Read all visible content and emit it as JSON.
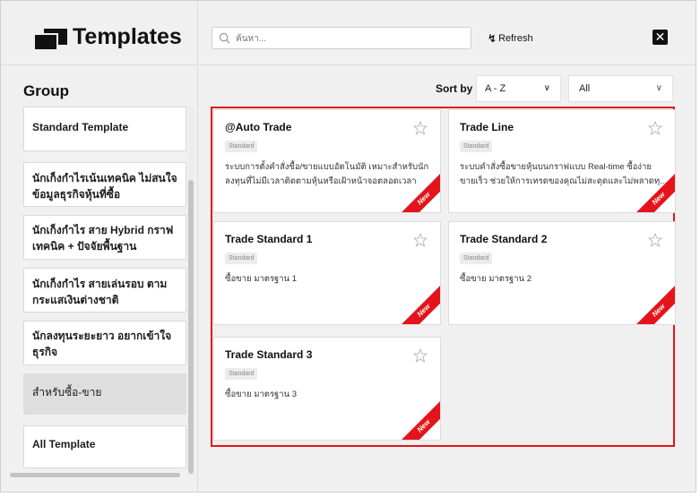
{
  "app": {
    "title": "Templates"
  },
  "sidebar": {
    "group_title": "Group",
    "items": [
      {
        "label": "Standard Template"
      },
      {
        "label_line1": "นักเก็งกำไรเน้นเทคนิค ไม่สนใจ",
        "label_line2": "ข้อมูลธุรกิจหุ้นที่ซื้อ"
      },
      {
        "label_line1": "นักเก็งกำไร สาย Hybrid กราฟ",
        "label_line2": "เทคนิค + ปัจจัยพื้นฐาน"
      },
      {
        "label_line1": "นักเก็งกำไร สายเล่นรอบ ตาม",
        "label_line2": "กระแสเงินต่างชาติ"
      },
      {
        "label_line1": "นักลงทุนระยะยาว อยากเข้าใจ",
        "label_line2": "ธุรกิจ"
      },
      {
        "label": "สำหรับซื้อ-ขาย"
      },
      {
        "label": "All Template"
      }
    ]
  },
  "toolbar": {
    "search_placeholder": "ค้นหา...",
    "refresh_label": "Refresh",
    "refresh_icon": "bolt-icon",
    "close_icon": "close-icon"
  },
  "sort": {
    "label": "Sort by",
    "selected": "A - Z",
    "filter_selected": "All"
  },
  "cards": [
    {
      "title": "@Auto Trade",
      "badge": "Standard",
      "desc_line1": "ระบบการตั้งคำสั่งซื้อ/ขายแบบอัตโนมัติ เหมาะสำหรับนัก",
      "desc_line2": "ลงทุนที่ไม่มีเวลาติดตามหุ้นหรือเฝ้าหน้าจอตลอดเวลา",
      "ribbon": "New"
    },
    {
      "title": "Trade Line",
      "badge": "Standard",
      "desc_line1": "ระบบคำสั่งซื้อขายหุ้นบนกราฟแบบ Real-time ซื้อง่าย",
      "desc_line2": "ขายเร็ว ช่วยให้การเทรดของคุณไม่สะดุดและไม่พลาดทุ...",
      "ribbon": "New"
    },
    {
      "title": "Trade Standard 1",
      "badge": "Standard",
      "desc_line1": "ซื้อขาย มาตรฐาน 1",
      "desc_line2": "",
      "ribbon": "New"
    },
    {
      "title": "Trade Standard 2",
      "badge": "Standard",
      "desc_line1": "ซื้อขาย มาตรฐาน 2",
      "desc_line2": "",
      "ribbon": "New"
    },
    {
      "title": "Trade Standard 3",
      "badge": "Standard",
      "desc_line1": "ซื้อขาย มาตรฐาน 3",
      "desc_line2": "",
      "ribbon": "New"
    }
  ],
  "colors": {
    "accent": "#e3141b",
    "background": "#f0f0f0"
  }
}
